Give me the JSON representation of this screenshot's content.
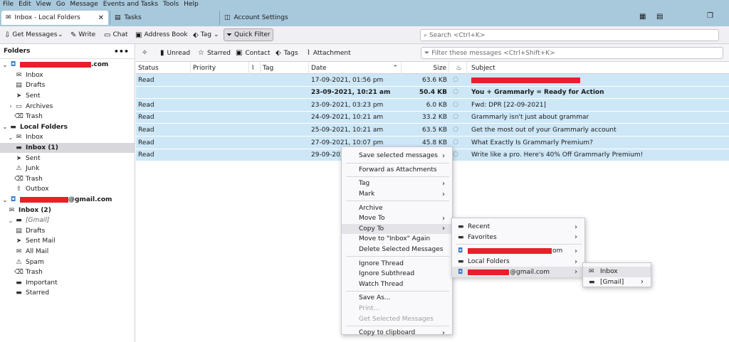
{
  "menubar": [
    "File",
    "Edit",
    "View",
    "Go",
    "Message",
    "Events and Tasks",
    "Tools",
    "Help"
  ],
  "tabs": [
    {
      "label": "Inbox - Local Folders",
      "active": true
    },
    {
      "label": "Tasks"
    },
    {
      "label": "Account Settings"
    }
  ],
  "toolbar": {
    "get_messages": "Get Messages",
    "write": "Write",
    "chat": "Chat",
    "address_book": "Address Book",
    "tag": "Tag",
    "quick_filter": "Quick Filter",
    "search_placeholder": "Search <Ctrl+K>"
  },
  "folders": {
    "header": "Folders",
    "rows": [
      {
        "label": ".com",
        "icon": "account-icon",
        "redacted": true,
        "bold": true
      },
      {
        "label": "Inbox",
        "icon": "inbox-icon"
      },
      {
        "label": "Drafts",
        "icon": "drafts-icon"
      },
      {
        "label": "Sent",
        "icon": "sent-icon"
      },
      {
        "label": "Archives",
        "icon": "archive-icon",
        "twisty": true
      },
      {
        "label": "Trash",
        "icon": "trash-icon"
      },
      {
        "label": "Local Folders",
        "icon": "folder-icon",
        "bold": true
      },
      {
        "label": "Inbox",
        "icon": "inbox-icon",
        "twisty": true
      },
      {
        "label": "Inbox (1)",
        "icon": "folder-icon",
        "bold": true,
        "selected": true
      },
      {
        "label": "Sent",
        "icon": "sent-icon"
      },
      {
        "label": "Junk",
        "icon": "junk-icon"
      },
      {
        "label": "Trash",
        "icon": "trash-icon"
      },
      {
        "label": "Outbox",
        "icon": "outbox-icon"
      },
      {
        "label": "@gmail.com",
        "icon": "account-icon",
        "redacted": true,
        "bold": true
      },
      {
        "label": "Inbox (2)",
        "icon": "inbox-icon",
        "bold": true
      },
      {
        "label": "[Gmail]",
        "icon": "folder-icon",
        "twisty": true,
        "italic": true
      },
      {
        "label": "Drafts",
        "icon": "drafts-icon"
      },
      {
        "label": "Sent Mail",
        "icon": "sent-icon"
      },
      {
        "label": "All Mail",
        "icon": "allmail-icon"
      },
      {
        "label": "Spam",
        "icon": "spam-icon"
      },
      {
        "label": "Trash",
        "icon": "trash-icon"
      },
      {
        "label": "Important",
        "icon": "folder-icon"
      },
      {
        "label": "Starred",
        "icon": "folder-icon"
      }
    ]
  },
  "filterbar": {
    "unread": "Unread",
    "starred": "Starred",
    "contact": "Contact",
    "tags": "Tags",
    "attachment": "Attachment",
    "filter_placeholder": "Filter these messages <Ctrl+Shift+K>"
  },
  "columns": {
    "status": "Status",
    "priority": "Priority",
    "tag": "Tag",
    "date": "Date",
    "size": "Size",
    "subject": "Subject"
  },
  "messages": [
    {
      "status": "Read",
      "date": "17-09-2021, 01:56 pm",
      "size": "63.6 KB",
      "subject": "",
      "redacted_subject": true
    },
    {
      "status": "",
      "date": "23-09-2021, 10:21 am",
      "size": "50.4 KB",
      "subject": "You + Grammarly = Ready for Action",
      "unread": true
    },
    {
      "status": "Read",
      "date": "23-09-2021, 03:23 pm",
      "size": "6.0 KB",
      "subject": "Fwd: DPR [22-09-2021]"
    },
    {
      "status": "Read",
      "date": "24-09-2021, 10:21 am",
      "size": "33.2 KB",
      "subject": "Grammarly isn't just about grammar"
    },
    {
      "status": "Read",
      "date": "25-09-2021, 10:21 am",
      "size": "63.5 KB",
      "subject": "Get the most out of your Grammarly account"
    },
    {
      "status": "Read",
      "date": "27-09-2021, 10:07 pm",
      "size": "45.8 KB",
      "subject": "What Exactly Is Grammarly Premium?"
    },
    {
      "status": "Read",
      "date": "29-09-2021",
      "size": "",
      "subject": "Write like a pro. Here's 40% Off Grammarly Premium!"
    }
  ],
  "context_menu": {
    "items": [
      {
        "label": "Save selected messages",
        "submenu": true
      },
      {
        "sep": true
      },
      {
        "label": "Forward as Attachments"
      },
      {
        "sep": true
      },
      {
        "label": "Tag",
        "submenu": true
      },
      {
        "label": "Mark",
        "submenu": true
      },
      {
        "sep": true
      },
      {
        "label": "Archive"
      },
      {
        "label": "Move To",
        "submenu": true
      },
      {
        "label": "Copy To",
        "submenu": true,
        "highlighted": true
      },
      {
        "label": "Move to \"Inbox\" Again"
      },
      {
        "label": "Delete Selected Messages"
      },
      {
        "sep": true
      },
      {
        "label": "Ignore Thread"
      },
      {
        "label": "Ignore Subthread"
      },
      {
        "label": "Watch Thread"
      },
      {
        "sep": true
      },
      {
        "label": "Save As..."
      },
      {
        "label": "Print...",
        "disabled": true
      },
      {
        "label": "Get Selected Messages",
        "disabled": true
      },
      {
        "sep": true
      },
      {
        "label": "Copy to clipboard",
        "submenu": true
      }
    ]
  },
  "copy_to_menu": {
    "items": [
      {
        "label": "Recent",
        "icon": "folder-icon",
        "submenu": true
      },
      {
        "label": "Favorites",
        "icon": "folder-icon",
        "submenu": true
      },
      {
        "sep": true
      },
      {
        "label": "om",
        "icon": "account-icon",
        "submenu": true,
        "redacted": true
      },
      {
        "label": "Local Folders",
        "icon": "folder-icon",
        "submenu": true
      },
      {
        "label": "@gmail.com",
        "icon": "account-icon",
        "submenu": true,
        "redacted": true,
        "highlighted": true
      }
    ]
  },
  "gmail_menu": {
    "items": [
      {
        "label": "Inbox",
        "icon": "inbox-icon",
        "highlighted": true
      },
      {
        "label": "[Gmail]",
        "icon": "folder-icon",
        "submenu": true
      }
    ]
  }
}
